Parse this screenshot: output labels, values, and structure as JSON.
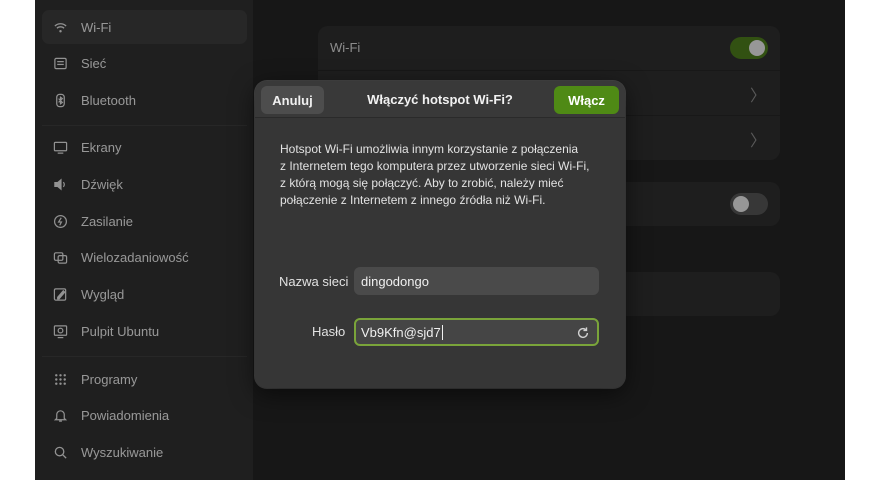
{
  "sidebar": {
    "items": [
      {
        "label": "Wi-Fi",
        "icon": "wifi-icon",
        "active": true
      },
      {
        "label": "Sieć",
        "icon": "network-icon"
      },
      {
        "label": "Bluetooth",
        "icon": "bluetooth-icon"
      },
      {
        "label": "Ekrany",
        "icon": "display-icon"
      },
      {
        "label": "Dźwięk",
        "icon": "speaker-icon"
      },
      {
        "label": "Zasilanie",
        "icon": "power-icon"
      },
      {
        "label": "Wielozadaniowość",
        "icon": "multitasking-icon"
      },
      {
        "label": "Wygląd",
        "icon": "appearance-icon"
      },
      {
        "label": "Pulpit Ubuntu",
        "icon": "ubuntu-desktop-icon"
      },
      {
        "label": "Programy",
        "icon": "apps-grid-icon"
      },
      {
        "label": "Powiadomienia",
        "icon": "bell-icon"
      },
      {
        "label": "Wyszukiwanie",
        "icon": "search-icon"
      }
    ]
  },
  "main": {
    "wifi_row_label": "Wi-Fi",
    "wifi_enabled": true,
    "second_toggle_enabled": false
  },
  "dialog": {
    "title": "Włączyć hotspot Wi-Fi?",
    "cancel_label": "Anuluj",
    "confirm_label": "Włącz",
    "description_lines": [
      "Hotspot Wi-Fi umożliwia innym korzystanie z połączenia",
      "z Internetem tego komputera przez utworzenie sieci Wi-Fi,",
      "z którą mogą się połączyć. Aby to zrobić, należy mieć",
      "połączenie z Internetem z innego źródła niż Wi-Fi."
    ],
    "network_name_label": "Nazwa sieci",
    "network_name_value": "dingodongo",
    "password_label": "Hasło",
    "password_value": "Vb9Kfn@sjd7"
  },
  "colors": {
    "accent": "#4f8a15",
    "focus_ring": "#7aa43a",
    "window_bg": "#242424",
    "sidebar_bg": "#303030"
  }
}
